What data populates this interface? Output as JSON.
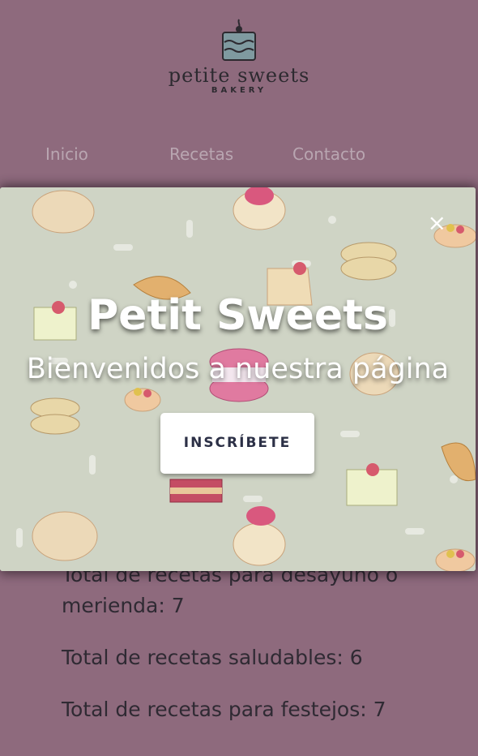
{
  "logo": {
    "name": "petite sweets",
    "sub": "BAKERY"
  },
  "nav": {
    "items": [
      {
        "label": "Inicio"
      },
      {
        "label": "Recetas"
      },
      {
        "label": "Contacto"
      }
    ]
  },
  "stats": [
    "Total de recetas para desayuno o merienda: 7",
    "Total de recetas saludables: 6",
    "Total de recetas para festejos: 7"
  ],
  "modal": {
    "title": "Petit Sweets",
    "subtitle": "Bienvenidos a nuestra página",
    "button_label": "INSCRÍBETE",
    "close_glyph": "×"
  },
  "colors": {
    "background": "#8e6a7d",
    "modal_bg": "#cfd4c5",
    "nav_text": "#b9a6b1",
    "button_text": "#2c3046"
  }
}
